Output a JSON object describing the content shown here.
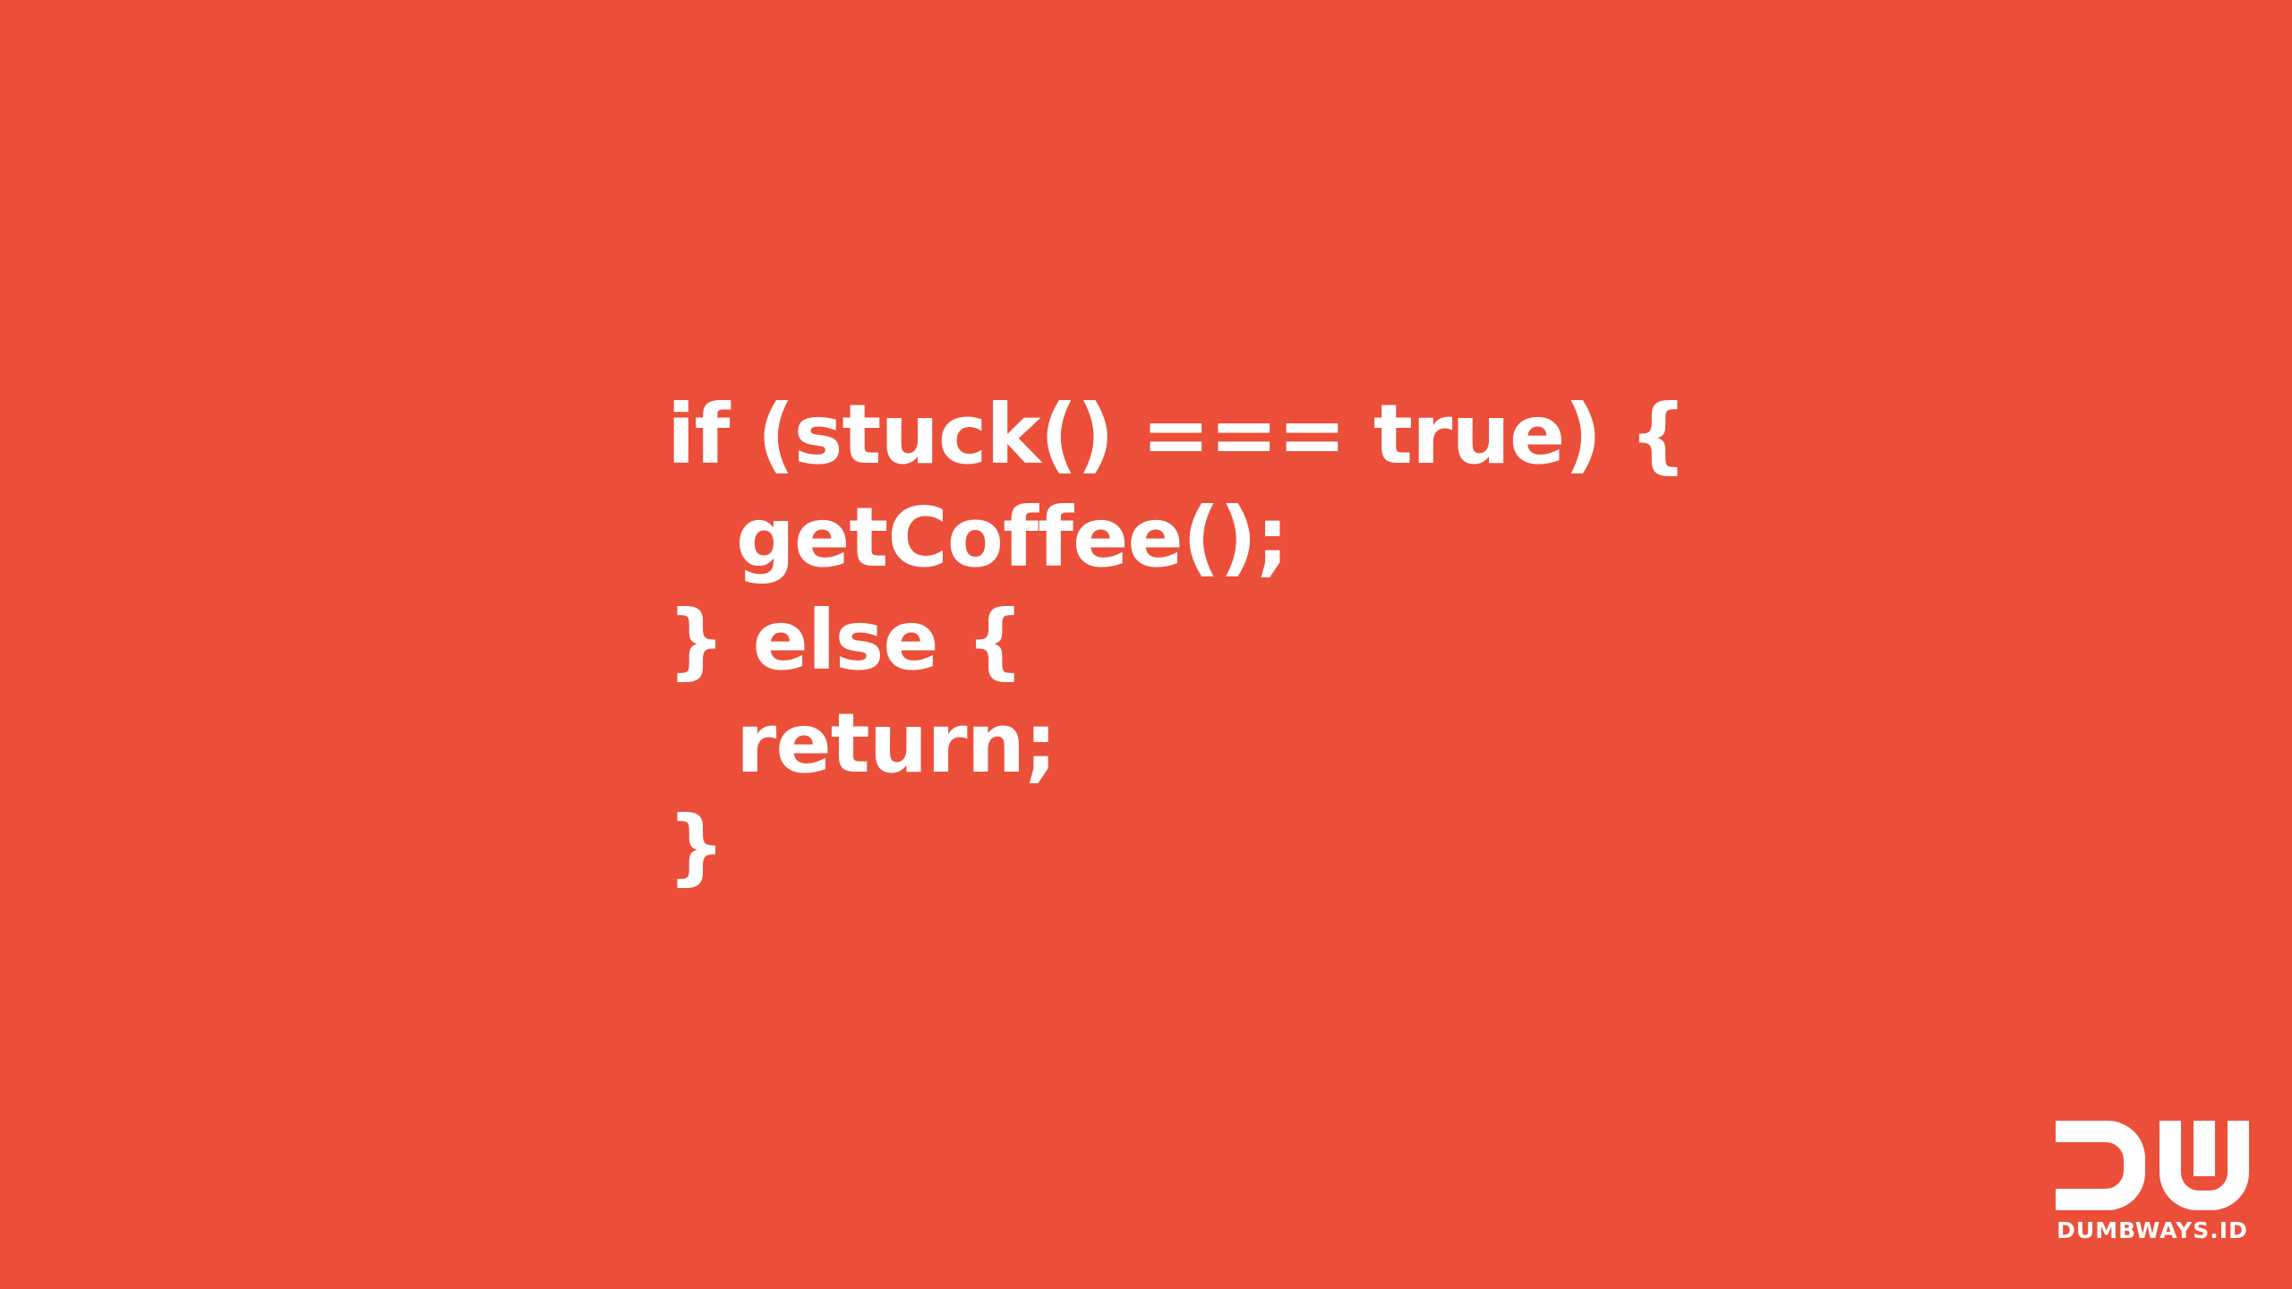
{
  "background_color": "#EB4F39",
  "text_color": "#FFFFFF",
  "code": {
    "lines": [
      "if (stuck() === true) {",
      "getCoffee();",
      "} else {",
      "return;",
      "}"
    ]
  },
  "logo": {
    "icon": "dumbways-dw-logo-icon",
    "text": "DUMBWAYS.ID"
  }
}
